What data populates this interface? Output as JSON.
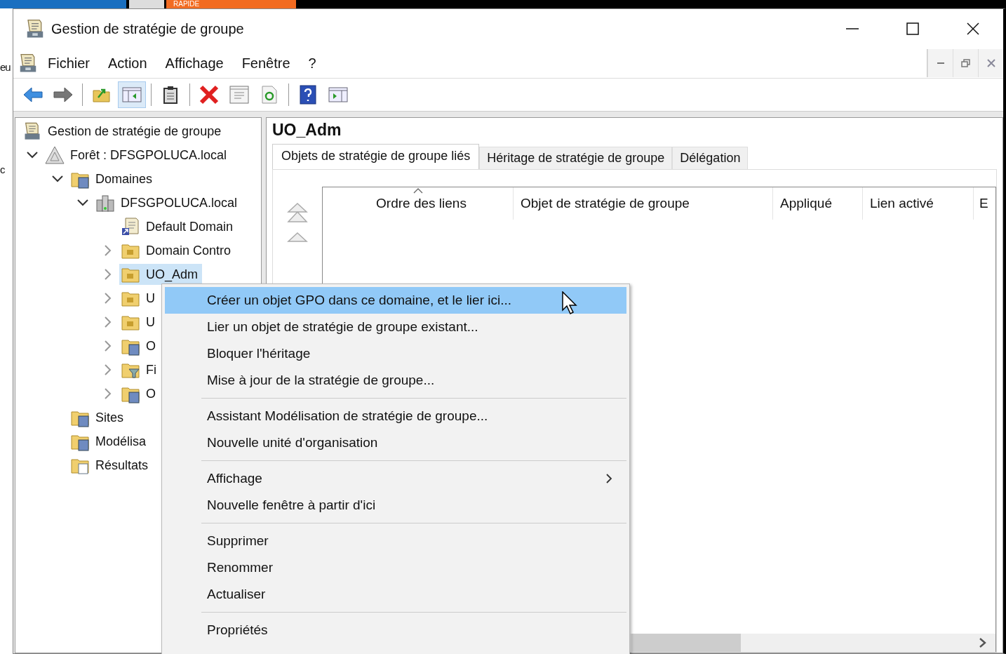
{
  "background": {
    "taskbar_tab": "RAPIDE",
    "fragments": [
      {
        "text": "eu"
      },
      {
        "text": "c"
      }
    ]
  },
  "window": {
    "title": "Gestion de stratégie de groupe"
  },
  "menu_bar": {
    "items": [
      {
        "label": "Fichier"
      },
      {
        "label": "Action"
      },
      {
        "label": "Affichage"
      },
      {
        "label": "Fenêtre"
      },
      {
        "label": "?"
      }
    ]
  },
  "toolbar": [
    {
      "kind": "back",
      "selected": false
    },
    {
      "kind": "forward",
      "selected": false
    },
    {
      "kind": "separator"
    },
    {
      "kind": "up-folder",
      "selected": false
    },
    {
      "kind": "tree-pane",
      "selected": true
    },
    {
      "kind": "separator"
    },
    {
      "kind": "clipboard",
      "selected": false
    },
    {
      "kind": "separator"
    },
    {
      "kind": "delete",
      "selected": false
    },
    {
      "kind": "properties",
      "selected": false
    },
    {
      "kind": "refresh",
      "selected": false
    },
    {
      "kind": "separator"
    },
    {
      "kind": "help",
      "selected": false
    },
    {
      "kind": "action-pane",
      "selected": false
    }
  ],
  "tree": [
    {
      "label": "Gestion de stratégie de groupe",
      "kind": "console",
      "selected": false,
      "children": [
        {
          "label": "Forêt : DFSGPOLUCA.local",
          "kind": "forest",
          "expanded": true,
          "selected": false,
          "children": [
            {
              "label": "Domaines",
              "kind": "domains",
              "expanded": true,
              "selected": false,
              "children": [
                {
                  "label": "DFSGPOLUCA.local",
                  "kind": "domain",
                  "expanded": true,
                  "selected": false,
                  "children": [
                    {
                      "label": "Default Domain",
                      "kind": "gpo-link",
                      "selected": false
                    },
                    {
                      "label": "Domain Contro",
                      "kind": "ou",
                      "expanded": false,
                      "selected": false
                    },
                    {
                      "label": "UO_Adm",
                      "kind": "ou",
                      "expanded": false,
                      "selected": true
                    },
                    {
                      "label": "U",
                      "kind": "ou",
                      "expanded": false,
                      "selected": false
                    },
                    {
                      "label": "U",
                      "kind": "ou",
                      "expanded": false,
                      "selected": false
                    },
                    {
                      "label": "O",
                      "kind": "gpo-folder",
                      "expanded": false,
                      "selected": false
                    },
                    {
                      "label": "Fi",
                      "kind": "filter-folder",
                      "expanded": false,
                      "selected": false
                    },
                    {
                      "label": "O",
                      "kind": "starter-folder",
                      "expanded": false,
                      "selected": false
                    }
                  ]
                }
              ]
            },
            {
              "label": "Sites",
              "kind": "sites",
              "selected": false
            },
            {
              "label": "Modélisa",
              "kind": "modeling",
              "selected": false
            },
            {
              "label": "Résultats",
              "kind": "results",
              "selected": false
            }
          ]
        }
      ]
    }
  ],
  "details": {
    "title": "UO_Adm",
    "tabs": [
      {
        "label": "Objets de stratégie de groupe liés",
        "selected": true
      },
      {
        "label": "Héritage de stratégie de groupe",
        "selected": false
      },
      {
        "label": "Délégation",
        "selected": false
      }
    ],
    "move_buttons": [
      {
        "kind": "top"
      },
      {
        "kind": "up"
      }
    ],
    "columns": [
      {
        "label": "Ordre des liens",
        "sorted": true
      },
      {
        "label": "Objet de stratégie de groupe",
        "sorted": false
      },
      {
        "label": "Appliqué",
        "sorted": false
      },
      {
        "label": "Lien activé",
        "sorted": false
      },
      {
        "label": "E",
        "sorted": false
      }
    ]
  },
  "context_menu": [
    {
      "kind": "item",
      "label": "Créer un objet GPO dans ce domaine, et le lier ici...",
      "selected": true
    },
    {
      "kind": "item",
      "label": "Lier un objet de stratégie de groupe existant...",
      "selected": false
    },
    {
      "kind": "item",
      "label": "Bloquer l'héritage",
      "selected": false
    },
    {
      "kind": "item",
      "label": "Mise à jour de la stratégie de groupe...",
      "selected": false
    },
    {
      "kind": "separator"
    },
    {
      "kind": "item",
      "label": "Assistant Modélisation de stratégie de groupe...",
      "selected": false
    },
    {
      "kind": "item",
      "label": "Nouvelle unité d'organisation",
      "selected": false
    },
    {
      "kind": "separator"
    },
    {
      "kind": "submenu",
      "label": "Affichage",
      "selected": false
    },
    {
      "kind": "item",
      "label": "Nouvelle fenêtre à partir d'ici",
      "selected": false
    },
    {
      "kind": "separator"
    },
    {
      "kind": "item",
      "label": "Supprimer",
      "selected": false
    },
    {
      "kind": "item",
      "label": "Renommer",
      "selected": false
    },
    {
      "kind": "item",
      "label": "Actualiser",
      "selected": false
    },
    {
      "kind": "separator"
    },
    {
      "kind": "item",
      "label": "Propriétés",
      "selected": false
    }
  ]
}
